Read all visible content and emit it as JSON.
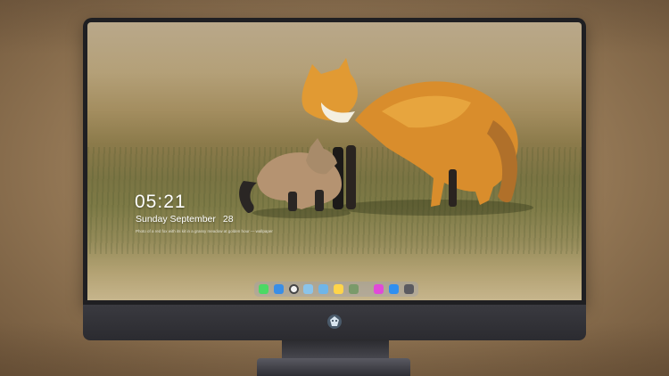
{
  "lockscreen": {
    "time": "05:21",
    "date_day": "Sunday September",
    "date_num": "28",
    "caption": "Photo of a red fox with its kit in a grassy meadow at golden hour — wallpaper"
  },
  "dock": {
    "apps": [
      {
        "icon": "messages-icon",
        "color": "#4cd964"
      },
      {
        "icon": "finder-icon",
        "color": "#3a8ee6"
      },
      {
        "icon": "safari-icon",
        "color": "#f2f2f2"
      },
      {
        "icon": "preview-icon",
        "color": "#8bc4ea"
      },
      {
        "icon": "clapper-icon",
        "color": "#6fb5e8"
      },
      {
        "icon": "notes-icon",
        "color": "#ffd54a"
      },
      {
        "icon": "photos-icon",
        "color": "#7a9a6a"
      },
      {
        "icon": "music-icon",
        "color": "#e04ad8"
      },
      {
        "icon": "appstore-icon",
        "color": "#2f8ff0"
      },
      {
        "icon": "camera-icon",
        "color": "#5a5a60"
      }
    ]
  },
  "monitor": {
    "logo": "chin-logo-icon"
  }
}
